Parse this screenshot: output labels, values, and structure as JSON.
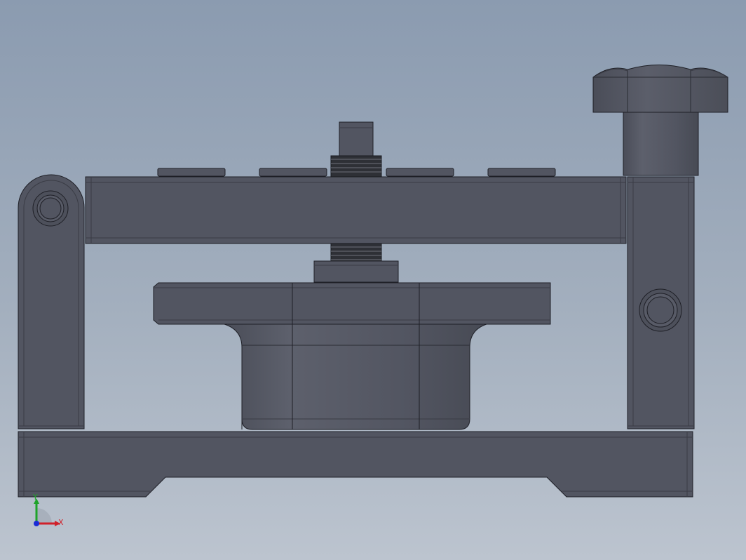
{
  "viewport": {
    "background_top": "#8b9bb0",
    "background_bottom": "#bcc4cf"
  },
  "model": {
    "body_color": "#525561",
    "edge_color": "#1e1f26",
    "thread_color": "#2e3036"
  },
  "triad": {
    "x_label": "X",
    "y_label": "Y",
    "x_color": "#d0202a",
    "y_color": "#1fa32a",
    "z_color": "#1a2bd6"
  }
}
